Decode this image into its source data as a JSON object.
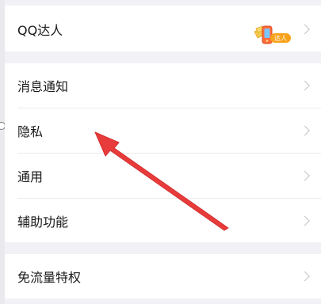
{
  "groups": [
    {
      "rows": [
        {
          "label": "QQ达人",
          "badge_text": "达人"
        }
      ]
    },
    {
      "rows": [
        {
          "label": "消息通知"
        },
        {
          "label": "隐私"
        },
        {
          "label": "通用"
        },
        {
          "label": "辅助功能"
        }
      ]
    },
    {
      "rows": [
        {
          "label": "免流量特权"
        }
      ]
    }
  ],
  "colors": {
    "page_bg": "#f2f2f6",
    "row_bg": "#ffffff",
    "arrow": "#e83b3b",
    "badge_orange": "#f7a21b"
  }
}
